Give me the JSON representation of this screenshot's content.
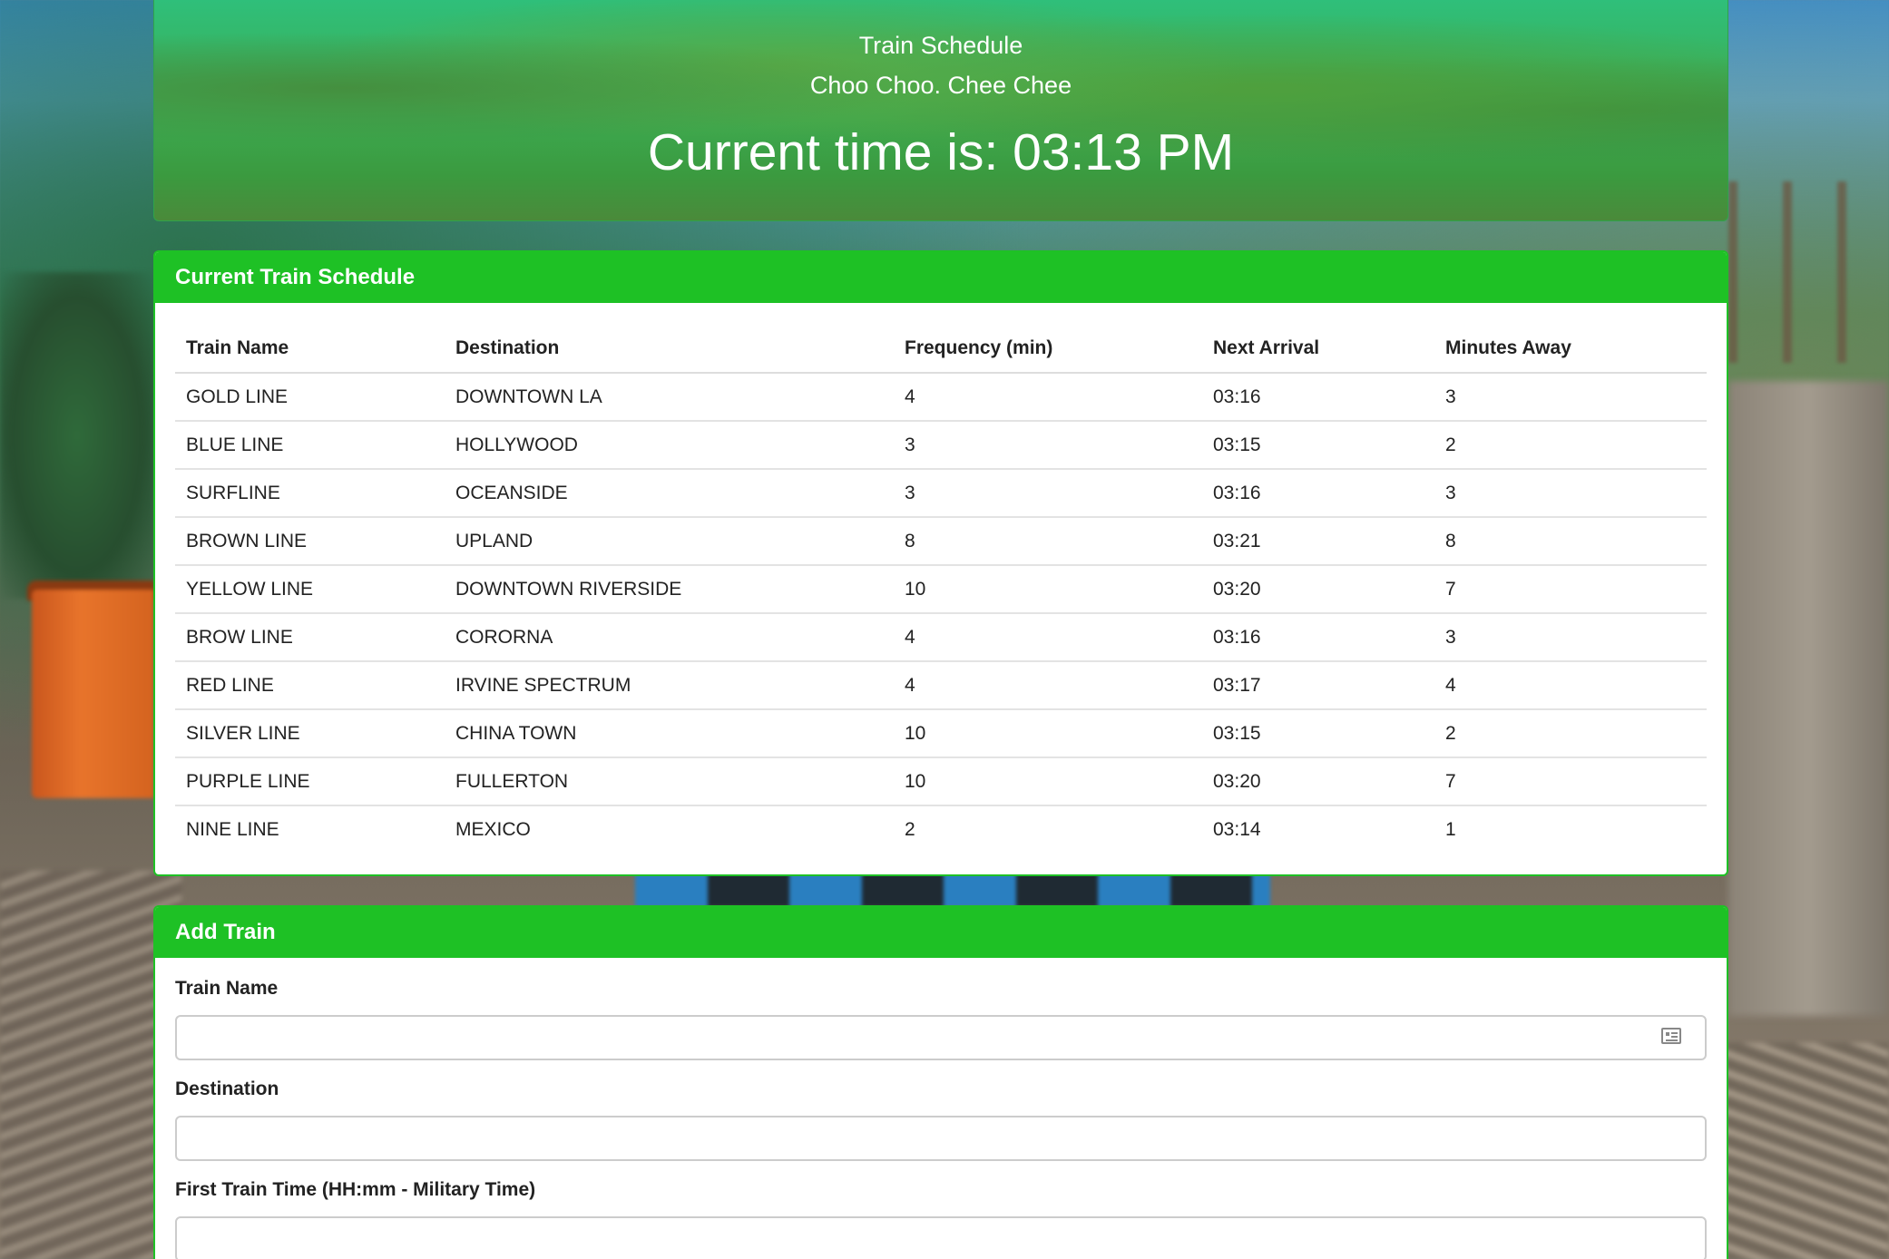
{
  "header": {
    "title": "Train Schedule",
    "subtitle": "Choo Choo. Chee Chee",
    "current_time": "Current time is: 03:13 PM"
  },
  "schedule": {
    "heading": "Current Train Schedule",
    "columns": [
      "Train Name",
      "Destination",
      "Frequency (min)",
      "Next Arrival",
      "Minutes Away"
    ],
    "rows": [
      [
        "GOLD LINE",
        "DOWNTOWN LA",
        "4",
        "03:16",
        "3"
      ],
      [
        "BLUE LINE",
        "HOLLYWOOD",
        "3",
        "03:15",
        "2"
      ],
      [
        "SURFLINE",
        "OCEANSIDE",
        "3",
        "03:16",
        "3"
      ],
      [
        "BROWN LINE",
        "UPLAND",
        "8",
        "03:21",
        "8"
      ],
      [
        "YELLOW LINE",
        "DOWNTOWN RIVERSIDE",
        "10",
        "03:20",
        "7"
      ],
      [
        "BROW LINE",
        "CORORNA",
        "4",
        "03:16",
        "3"
      ],
      [
        "RED LINE",
        "IRVINE SPECTRUM",
        "4",
        "03:17",
        "4"
      ],
      [
        "SILVER LINE",
        "CHINA TOWN",
        "10",
        "03:15",
        "2"
      ],
      [
        "PURPLE LINE",
        "FULLERTON",
        "10",
        "03:20",
        "7"
      ],
      [
        "NINE LINE",
        "MEXICO",
        "2",
        "03:14",
        "1"
      ]
    ]
  },
  "add_train": {
    "heading": "Add Train",
    "train_name_label": "Train Name",
    "train_name_value": "",
    "destination_label": "Destination",
    "destination_value": "",
    "first_time_label": "First Train Time (HH:mm - Military Time)",
    "first_time_value": ""
  },
  "colors": {
    "accent": "#1ec125",
    "text": "#222222"
  },
  "icons": {
    "train_name_input": "contact-card-icon"
  }
}
